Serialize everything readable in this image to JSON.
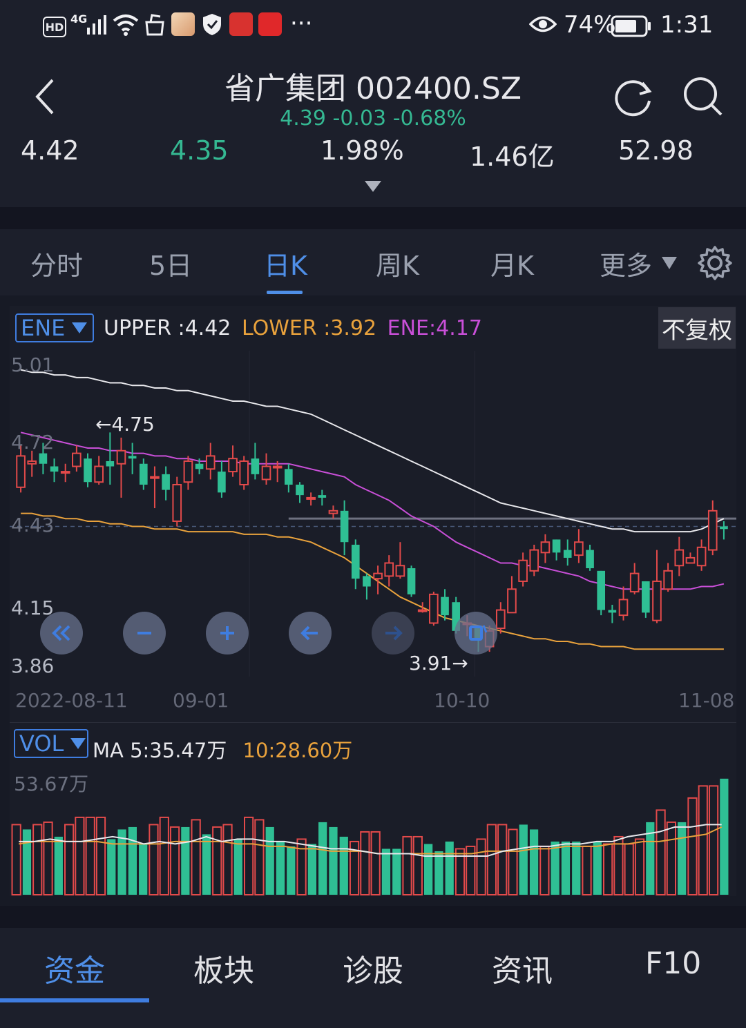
{
  "status_bar": {
    "network": "4G",
    "hd": "HD",
    "battery": "74%",
    "time": "1:31",
    "more": "···"
  },
  "header": {
    "title": "省广集团 002400.SZ",
    "quote": {
      "price": "4.39",
      "change": "-0.03",
      "change_pct": "-0.68%"
    },
    "stats": [
      "4.42",
      "4.35",
      "1.98%",
      "1.46亿",
      "52.98"
    ]
  },
  "tabs": [
    "分时",
    "5日",
    "日K",
    "周K",
    "月K",
    "更多"
  ],
  "active_tab": "日K",
  "main_chart": {
    "indicator": "ENE",
    "legend": {
      "upper": "UPPER :4.42",
      "lower": "LOWER :3.92",
      "ene": "ENE:4.17"
    },
    "adjust": "不复权",
    "y_ticks": [
      "5.01",
      "4.72",
      "4.43",
      "4.15",
      "3.86"
    ],
    "x_ticks": [
      "2022-08-11",
      "09-01",
      "10-10",
      "11-08"
    ],
    "annotations": {
      "high": "←4.75",
      "low": "3.91→"
    }
  },
  "volume_chart": {
    "indicator": "VOL",
    "legend": {
      "ma5": "MA 5:35.47万",
      "ma10": "10:28.60万"
    },
    "y_top": "53.67万"
  },
  "bottom_nav": [
    "资金",
    "板块",
    "诊股",
    "资讯",
    "F10"
  ],
  "colors": {
    "up": "#e34a4a",
    "down": "#2fbf94",
    "accent": "#4f8fe8",
    "upper_line": "#e8e8ec",
    "lower_line": "#e9a23c",
    "ene_line": "#c94fd8"
  },
  "chart_data": [
    {
      "type": "candlestick",
      "ylim": [
        3.86,
        5.01
      ],
      "x_ticks": [
        "2022-08-11",
        "09-01",
        "10-10",
        "11-08"
      ],
      "candles": [
        [
          4.54,
          4.66,
          4.7,
          4.52
        ],
        [
          4.63,
          4.64,
          4.68,
          4.58
        ],
        [
          4.67,
          4.63,
          4.71,
          4.59
        ],
        [
          4.62,
          4.6,
          4.65,
          4.56
        ],
        [
          4.6,
          4.6,
          4.63,
          4.56
        ],
        [
          4.62,
          4.67,
          4.7,
          4.6
        ],
        [
          4.65,
          4.56,
          4.67,
          4.54
        ],
        [
          4.56,
          4.62,
          4.66,
          4.55
        ],
        [
          4.64,
          4.62,
          4.75,
          4.55
        ],
        [
          4.63,
          4.68,
          4.73,
          4.5
        ],
        [
          4.66,
          4.65,
          4.71,
          4.59
        ],
        [
          4.63,
          4.55,
          4.65,
          4.53
        ],
        [
          4.58,
          4.58,
          4.62,
          4.46
        ],
        [
          4.59,
          4.53,
          4.62,
          4.49
        ],
        [
          4.41,
          4.55,
          4.58,
          4.39
        ],
        [
          4.56,
          4.64,
          4.66,
          4.53
        ],
        [
          4.63,
          4.61,
          4.65,
          4.59
        ],
        [
          4.61,
          4.66,
          4.71,
          4.57
        ],
        [
          4.6,
          4.52,
          4.64,
          4.5
        ],
        [
          4.6,
          4.65,
          4.7,
          4.58
        ],
        [
          4.55,
          4.64,
          4.66,
          4.53
        ],
        [
          4.65,
          4.59,
          4.71,
          4.57
        ],
        [
          4.57,
          4.62,
          4.67,
          4.55
        ],
        [
          4.62,
          4.62,
          4.64,
          4.56
        ],
        [
          4.61,
          4.55,
          4.63,
          4.52
        ],
        [
          4.55,
          4.51,
          4.56,
          4.48
        ],
        [
          4.5,
          4.5,
          4.52,
          4.47
        ],
        [
          4.51,
          4.5,
          4.53,
          4.47
        ],
        [
          4.44,
          4.45,
          4.47,
          4.42
        ],
        [
          4.45,
          4.33,
          4.49,
          4.28
        ],
        [
          4.32,
          4.19,
          4.34,
          4.15
        ],
        [
          4.2,
          4.16,
          4.21,
          4.11
        ],
        [
          4.19,
          4.21,
          4.24,
          4.13
        ],
        [
          4.2,
          4.25,
          4.28,
          4.16
        ],
        [
          4.2,
          4.24,
          4.33,
          4.19
        ],
        [
          4.23,
          4.13,
          4.24,
          4.12
        ],
        [
          4.07,
          4.07,
          4.1,
          4.06
        ],
        [
          4.02,
          4.13,
          4.14,
          4.01
        ],
        [
          4.12,
          4.05,
          4.15,
          4.03
        ],
        [
          4.1,
          3.99,
          4.12,
          3.98
        ],
        [
          4.02,
          4.02,
          4.05,
          3.97
        ],
        [
          4.0,
          3.96,
          4.01,
          3.91
        ],
        [
          3.93,
          3.99,
          4.01,
          3.91
        ],
        [
          4.0,
          4.07,
          4.1,
          3.98
        ],
        [
          4.06,
          4.15,
          4.2,
          4.07
        ],
        [
          4.18,
          4.26,
          4.29,
          4.16
        ],
        [
          4.22,
          4.3,
          4.32,
          4.2
        ],
        [
          4.29,
          4.33,
          4.36,
          4.25
        ],
        [
          4.34,
          4.29,
          4.34,
          4.26
        ],
        [
          4.3,
          4.27,
          4.34,
          4.24
        ],
        [
          4.28,
          4.33,
          4.38,
          4.25
        ],
        [
          4.3,
          4.23,
          4.32,
          4.22
        ],
        [
          4.22,
          4.07,
          4.22,
          4.05
        ],
        [
          4.07,
          4.06,
          4.09,
          4.02
        ],
        [
          4.05,
          4.11,
          4.16,
          4.03
        ],
        [
          4.14,
          4.21,
          4.25,
          4.13
        ],
        [
          4.18,
          4.06,
          4.18,
          4.04
        ],
        [
          4.03,
          4.18,
          4.3,
          4.02
        ],
        [
          4.15,
          4.22,
          4.25,
          4.14
        ],
        [
          4.24,
          4.3,
          4.35,
          4.2
        ],
        [
          4.25,
          4.27,
          4.29,
          4.25
        ],
        [
          4.24,
          4.31,
          4.34,
          4.22
        ],
        [
          4.3,
          4.45,
          4.49,
          4.28
        ],
        [
          4.39,
          4.38,
          4.41,
          4.34
        ]
      ],
      "upper": [
        4.99,
        4.98,
        4.98,
        4.97,
        4.97,
        4.96,
        4.96,
        4.95,
        4.94,
        4.94,
        4.93,
        4.93,
        4.92,
        4.92,
        4.91,
        4.91,
        4.9,
        4.89,
        4.88,
        4.87,
        4.87,
        4.86,
        4.85,
        4.85,
        4.84,
        4.83,
        4.82,
        4.8,
        4.78,
        4.76,
        4.74,
        4.72,
        4.7,
        4.68,
        4.66,
        4.64,
        4.62,
        4.6,
        4.58,
        4.56,
        4.54,
        4.52,
        4.5,
        4.48,
        4.47,
        4.46,
        4.45,
        4.44,
        4.43,
        4.42,
        4.41,
        4.4,
        4.39,
        4.38,
        4.38,
        4.37,
        4.37,
        4.37,
        4.37,
        4.37,
        4.37,
        4.38,
        4.4,
        4.42
      ],
      "ene": [
        4.75,
        4.74,
        4.73,
        4.72,
        4.71,
        4.7,
        4.69,
        4.69,
        4.68,
        4.68,
        4.67,
        4.67,
        4.66,
        4.66,
        4.65,
        4.65,
        4.64,
        4.64,
        4.64,
        4.64,
        4.63,
        4.63,
        4.63,
        4.63,
        4.63,
        4.62,
        4.61,
        4.6,
        4.59,
        4.58,
        4.55,
        4.53,
        4.51,
        4.49,
        4.46,
        4.43,
        4.41,
        4.39,
        4.36,
        4.33,
        4.31,
        4.29,
        4.27,
        4.25,
        4.25,
        4.24,
        4.24,
        4.23,
        4.22,
        4.21,
        4.2,
        4.18,
        4.17,
        4.16,
        4.15,
        4.15,
        4.15,
        4.15,
        4.15,
        4.15,
        4.15,
        4.16,
        4.16,
        4.17
      ],
      "lower": [
        4.44,
        4.44,
        4.43,
        4.43,
        4.42,
        4.42,
        4.41,
        4.41,
        4.4,
        4.4,
        4.39,
        4.39,
        4.38,
        4.38,
        4.38,
        4.37,
        4.37,
        4.37,
        4.37,
        4.37,
        4.36,
        4.36,
        4.36,
        4.35,
        4.35,
        4.34,
        4.33,
        4.31,
        4.29,
        4.27,
        4.24,
        4.21,
        4.18,
        4.15,
        4.12,
        4.1,
        4.08,
        4.06,
        4.04,
        4.03,
        4.02,
        4.01,
        4.0,
        3.99,
        3.98,
        3.97,
        3.96,
        3.96,
        3.95,
        3.95,
        3.94,
        3.94,
        3.93,
        3.93,
        3.93,
        3.92,
        3.92,
        3.92,
        3.92,
        3.92,
        3.92,
        3.92,
        3.92,
        3.92
      ],
      "reference_line": 4.42,
      "current_price": 4.39
    },
    {
      "type": "bar",
      "unit": "万",
      "ylim": [
        0,
        53.67
      ],
      "values": [
        29,
        27,
        29,
        30,
        24,
        29,
        32,
        32,
        32,
        23,
        27,
        28,
        21,
        29,
        32,
        28,
        28,
        31,
        25,
        28,
        29,
        23,
        32,
        31,
        28,
        22,
        20,
        23,
        21,
        30,
        28,
        24,
        22,
        26,
        26,
        19,
        19,
        24,
        24,
        21,
        18,
        22,
        19,
        20,
        23,
        29,
        29,
        27,
        29,
        27,
        20,
        22,
        22,
        22,
        20,
        22,
        21,
        24,
        21,
        23,
        30,
        35,
        30,
        30,
        40,
        45,
        45,
        48
      ],
      "volume_colors": [
        "up",
        "down",
        "up",
        "up",
        "down",
        "up",
        "up",
        "up",
        "up",
        "down",
        "down",
        "down",
        "down",
        "up",
        "up",
        "up",
        "down",
        "up",
        "down",
        "up",
        "up",
        "down",
        "up",
        "up",
        "down",
        "down",
        "down",
        "up",
        "down",
        "down",
        "down",
        "down",
        "up",
        "up",
        "up",
        "down",
        "down",
        "up",
        "up",
        "down",
        "down",
        "down",
        "up",
        "up",
        "up",
        "up",
        "up",
        "up",
        "down",
        "down",
        "up",
        "down",
        "down",
        "down",
        "up",
        "down",
        "up",
        "up",
        "up",
        "up",
        "down",
        "up",
        "up",
        "down",
        "up",
        "up",
        "up",
        "down"
      ],
      "ma5": [
        22,
        22,
        23,
        22,
        22,
        23,
        24,
        23,
        21,
        22,
        21,
        22,
        24,
        22,
        23,
        23,
        22,
        22,
        21,
        20,
        19,
        19,
        18,
        17,
        17,
        17,
        16,
        16,
        16,
        16,
        16,
        18,
        19,
        20,
        20,
        21,
        21,
        22,
        22,
        24,
        25,
        26,
        28,
        28,
        29,
        29
      ],
      "ma10": [
        21,
        22,
        22,
        22,
        22,
        22,
        21,
        21,
        21,
        21,
        22,
        22,
        22,
        22,
        21,
        21,
        20,
        20,
        19,
        19,
        18,
        18,
        18,
        17,
        17,
        17,
        17,
        17,
        17,
        17,
        18,
        18,
        18,
        19,
        19,
        20,
        20,
        20,
        21,
        21,
        22,
        22,
        23,
        24,
        25,
        28
      ]
    }
  ]
}
